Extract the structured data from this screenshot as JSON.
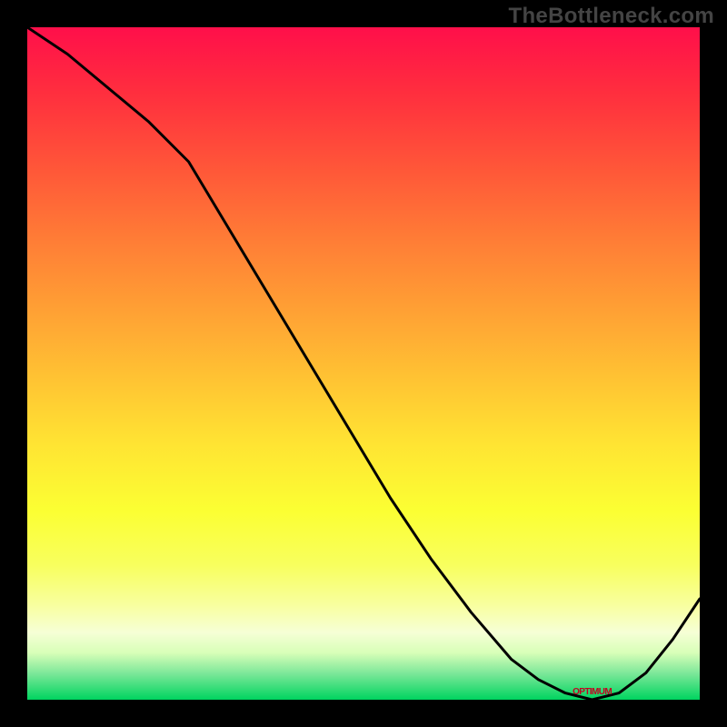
{
  "watermark": "TheBottleneck.com",
  "optimum_label": "OPTIMUM",
  "colors": {
    "curve_stroke": "#000000",
    "optimum_text": "#c40020",
    "watermark_text": "#444444"
  },
  "chart_data": {
    "type": "line",
    "title": "",
    "xlabel": "",
    "ylabel": "",
    "xlim": [
      0,
      100
    ],
    "ylim": [
      0,
      100
    ],
    "x": [
      0,
      6,
      12,
      18,
      24,
      30,
      36,
      42,
      48,
      54,
      60,
      66,
      72,
      76,
      80,
      84,
      88,
      92,
      96,
      100
    ],
    "values": [
      100,
      96,
      91,
      86,
      80,
      70,
      60,
      50,
      40,
      30,
      21,
      13,
      6,
      3,
      1,
      0,
      1,
      4,
      9,
      15
    ],
    "optimum_x": 84,
    "optimum_y": 0
  }
}
